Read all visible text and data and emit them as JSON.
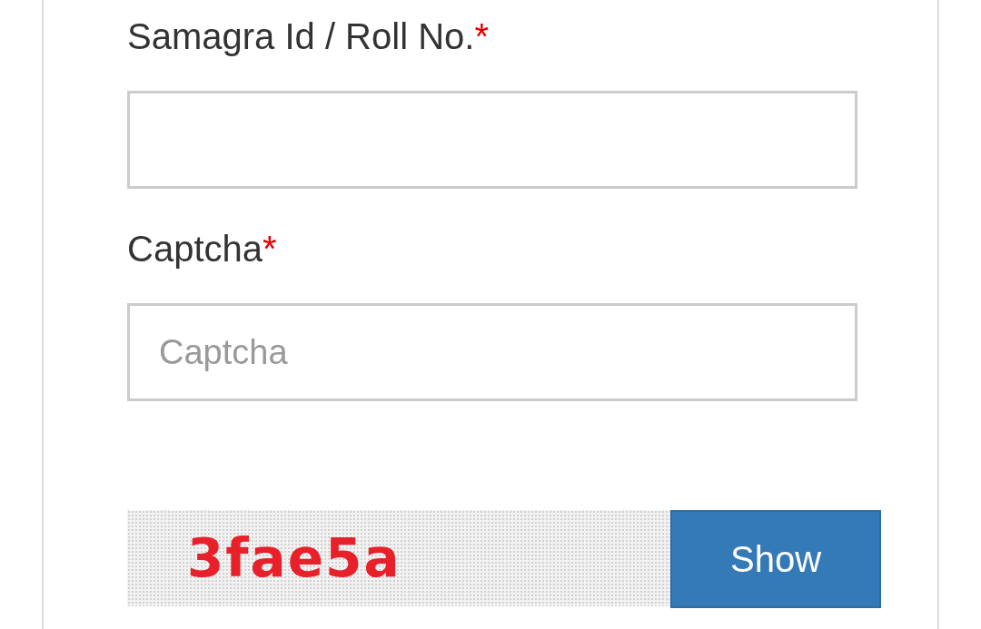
{
  "fields": [
    {
      "label": "Samagra Id / Roll No.",
      "required_mark": "*"
    },
    {
      "label": "Captcha",
      "required_mark": "*",
      "placeholder": "Captcha"
    }
  ],
  "captcha": {
    "code": "3fae5a"
  },
  "button": "Show"
}
